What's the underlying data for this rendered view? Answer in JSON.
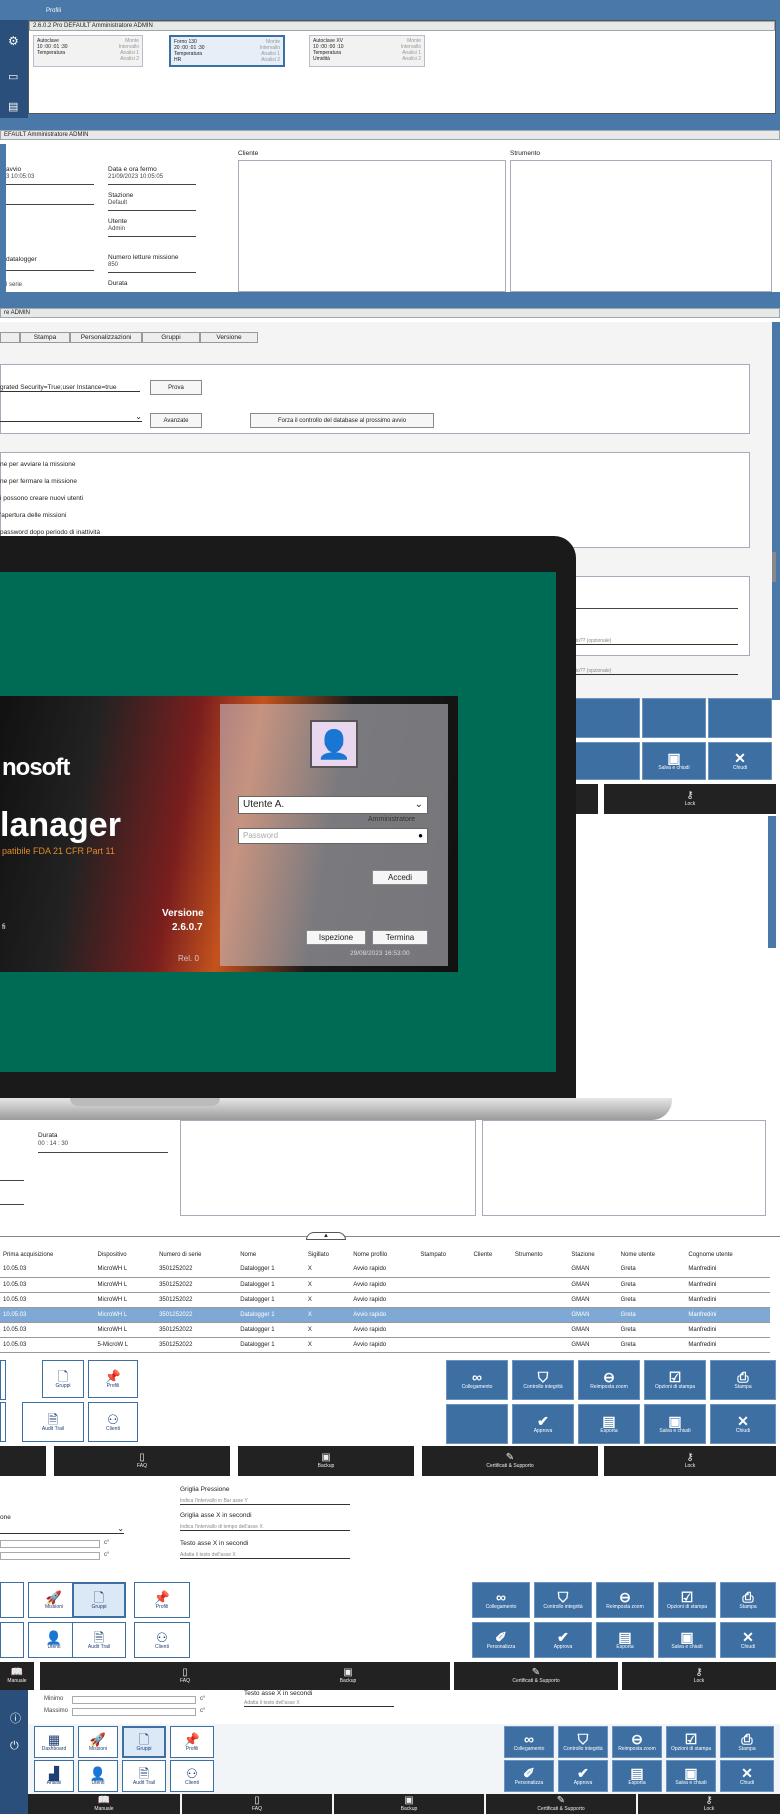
{
  "colors": {
    "accent": "#3d6fa3",
    "teal": "#006b55",
    "header": "#4a78a8"
  },
  "profiles_window": {
    "title": "Profili",
    "subtitle": "2.6.0.2 Pro DEFAULT Amministratore ADMIN",
    "cards": [
      {
        "name": "Autoclave",
        "l1": "10 :00 :01 :30",
        "l2": "Temperatura",
        "r0": "Monte",
        "r1": "Intervallo",
        "r2": "Analisi 1",
        "r3": "Analisi 2"
      },
      {
        "name": "Forno 130",
        "l1": "20 :00 :01 :30",
        "l2": "Temperatura",
        "l3": "HR",
        "r0": "Monte",
        "r1": "Intervallo",
        "r2": "Analisi 1",
        "r3": "Analisi 2"
      },
      {
        "name": "Autoclave XV",
        "l1": "10 :00 :00 :10",
        "l2": "Temperatura",
        "l3": "Umidità",
        "r0": "Monte",
        "r1": "Intervallo",
        "r2": "Analisi 1",
        "r3": "Analisi 2"
      }
    ]
  },
  "mission_window": {
    "title": "EFAULT Amministratore ADMIN",
    "start_label": "avvio",
    "start_val": "3 10:05:03",
    "stop_label": "Data e ora fermo",
    "stop_val": "21/09/2023 10:05:05",
    "station_label": "Stazione",
    "station_val": "Default",
    "user_label": "Utente",
    "user_val": "Admin",
    "datalogger_label": "datalogger",
    "readings_label": "Numero letture missione",
    "readings_val": "850",
    "series_label": "l serie",
    "duration_label": "Durata",
    "client_label": "Cliente",
    "instrument_label": "Strumento"
  },
  "settings_window": {
    "title": "re ADMIN",
    "tabs": [
      "Stampa",
      "Personalizzazioni",
      "Gruppi",
      "Versione"
    ],
    "conn_string": "grated Security=True;user Instance=true",
    "test_button": "Prova",
    "advanced_button": "Avanzate",
    "force_button": "Forza il controllo del database al prossimo avvio",
    "checks": [
      "ne per avviare la missione",
      "ne per fermare la missione",
      "i possono creare nuovi utenti",
      "'apertura delle missioni",
      "password dopo periodo di inattività"
    ],
    "hint1": "dato?? (opzionale)",
    "hint2": "dato?? (opzionale)"
  },
  "right_buttons_top": {
    "save": "Salva e chiudi",
    "close": "Chiudi",
    "lock": "Lock"
  },
  "login": {
    "brand": "nosoft",
    "product": "lanager",
    "subtitle": "patibile FDA 21 CFR Part 11",
    "fi": "fi",
    "version_label": "Versione",
    "version": "2.6.0.7",
    "rel": "Rel. 0",
    "user": "Utente A.",
    "role": "Amministratore",
    "password_placeholder": "Password",
    "login_button": "Accedi",
    "inspect_button": "Ispezione",
    "exit_button": "Termina",
    "datetime": "29/08/2023  16:53:00"
  },
  "lower_mission": {
    "duration_label": "Durata",
    "duration_val": "00 : 14 : 30"
  },
  "table": {
    "headers": [
      "Prima acquisizione",
      "Dispositivo",
      "Numero di serie",
      "Nome",
      "Sigillato",
      "Nome profilo",
      "Stampato",
      "Cliente",
      "Strumento",
      "Stazione",
      "Nome utente",
      "Cognome utente"
    ],
    "rows": [
      [
        "10.05.03",
        "MicroWH L",
        "3501252022",
        "Datalogger 1",
        "X",
        "Avvio rapido",
        "",
        "",
        "",
        "GMAN",
        "Greta",
        "Manfredini"
      ],
      [
        "10.05.03",
        "MicroWH L",
        "3501252022",
        "Datalogger 1",
        "X",
        "Avvio rapido",
        "",
        "",
        "",
        "GMAN",
        "Greta",
        "Manfredini"
      ],
      [
        "10.05.03",
        "MicroWH L",
        "3501252022",
        "Datalogger 1",
        "X",
        "Avvio rapido",
        "",
        "",
        "",
        "GMAN",
        "Greta",
        "Manfredini"
      ],
      [
        "10.05.03",
        "MicroWH L",
        "3501252022",
        "Datalogger 1",
        "X",
        "Avvio rapido",
        "",
        "",
        "",
        "GMAN",
        "Greta",
        "Manfredini"
      ],
      [
        "10.05.03",
        "MicroWH L",
        "3501252022",
        "Datalogger 1",
        "X",
        "Avvio rapido",
        "",
        "",
        "",
        "GMAN",
        "Greta",
        "Manfredini"
      ],
      [
        "10.05.03",
        "5-MicroW L",
        "3501252022",
        "Datalogger 1",
        "X",
        "Avvio rapido",
        "",
        "",
        "",
        "GMAN",
        "Greta",
        "Manfredini"
      ]
    ]
  },
  "toolbar": {
    "gruppi": "Gruppi",
    "profili": "Profili",
    "audit": "Audit Trail",
    "clienti": "Clienti",
    "missioni": "Missioni",
    "utenti": "Utenti",
    "dashboard": "Dashboard",
    "analisi": "Analisi",
    "collegamento": "Collegamento",
    "integrita": "Controllo integrità",
    "zoom": "Reimposta zoom",
    "opzioni": "Opzioni di stampa",
    "stampa": "Stampa",
    "personalizza": "Personalizza",
    "approva": "Approva",
    "esporta": "Esporta",
    "salva": "Salva e chiudi",
    "chiudi": "Chiudi",
    "faq": "FAQ",
    "backup": "Backup",
    "cert": "Certificati & Supporto",
    "lock": "Lock",
    "manuale": "Manuale"
  },
  "chart_settings": {
    "pressione": "Griglia Pressione",
    "pressione_hint": "Indica l'intervallo in Bar asse Y",
    "gridx": "Griglia asse X in secondi",
    "gridx_hint": "Indica l'intervallo di tempo dell'asse X",
    "textx": "Testo asse X in secondi",
    "textx_hint": "Adatta il testo dell'asse X",
    "one": "one",
    "unit": "c°",
    "min": "Minimo",
    "max": "Massimo"
  }
}
